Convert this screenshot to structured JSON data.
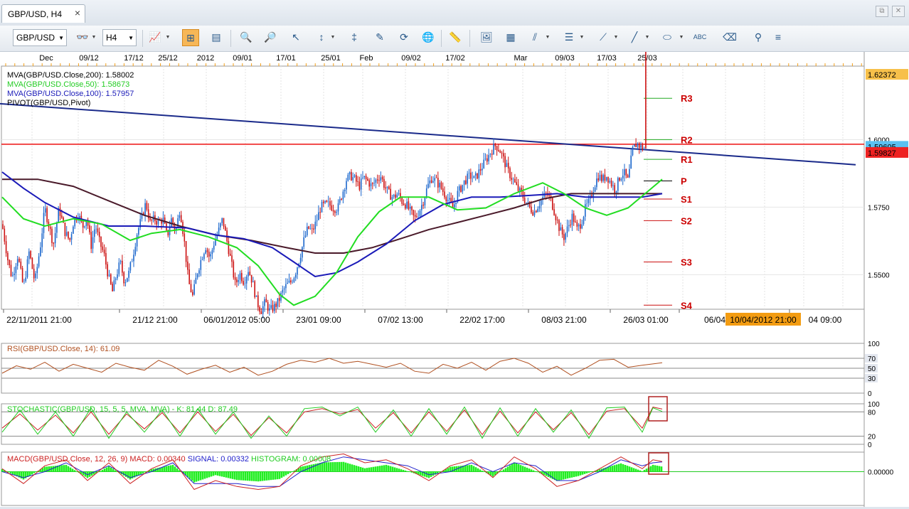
{
  "window": {
    "tab_title": "GBP/USD, H4",
    "close_glyph": "×",
    "restore_glyph": "⧉",
    "close_window_glyph": "✕"
  },
  "toolbar": {
    "symbol": "GBP/USD",
    "timeframe": "H4",
    "icons": [
      "glasses-icon",
      "chart-type-icon",
      "zoom-fit-icon",
      "data-window-icon",
      "zoom-in-icon",
      "zoom-out-icon",
      "cursor-icon",
      "indicator-icon",
      "cross-line-icon",
      "template-icon",
      "refresh-icon",
      "globe-icon",
      "ruler-icon",
      "image-icon",
      "screenshot-icon",
      "fibonacci-icon",
      "channel-icon",
      "trendline-icon",
      "line-icon",
      "ellipse-icon",
      "text-icon",
      "eraser-icon",
      "layout-icon",
      "menu-icon"
    ]
  },
  "colors": {
    "mva200": "#4a1a2a",
    "mva50": "#22dd22",
    "mva100": "#1a1ab8",
    "pivot": "#000000",
    "trendline": "#1a2a8a",
    "hline": "#ee1111",
    "pivot_label": "#cc0000",
    "bull": "#1a66cc",
    "bear": "#cc1111",
    "rsi": "#b05020",
    "stoch_k": "#22cc22",
    "stoch_d": "#cc2222",
    "macd": "#cc2222",
    "signal": "#2222cc",
    "hist": "#22ee22",
    "price_tag_current": "#5bc0f0",
    "price_tag_line": "#ee2222",
    "price_tag_top": "#f7c04a",
    "time_tag": "#f39c12"
  },
  "chart_data": [
    {
      "type": "candlestick",
      "symbol": "GBP/USD",
      "timeframe": "H4",
      "top_axis": [
        "Dec",
        "09/12",
        "17/12",
        "25/12",
        "2012",
        "09/01",
        "17/01",
        "25/01",
        "Feb",
        "09/02",
        "17/02",
        "Mar",
        "09/03",
        "17/03",
        "25/03"
      ],
      "bottom_axis": [
        "22/11/2011 21:00",
        "21/12 21:00",
        "06/01/2012 05:00",
        "23/01 09:00",
        "07/02 13:00",
        "22/02 17:00",
        "08/03 21:00",
        "26/03 01:00",
        "06/04",
        "04 09:00"
      ],
      "cursor_time_label": "10/04/2012 21:00",
      "ylim": [
        1.5372,
        1.6272
      ],
      "y_ticks": [
        1.55,
        1.575,
        1.6
      ],
      "y_tick_labels": [
        "1.5500",
        "1.5750",
        "1.6000"
      ],
      "price_tags": {
        "top": "1.62372",
        "current": "1.59605",
        "line": "1.59827"
      },
      "legend": [
        {
          "text": "MVA(GBP/USD.Close,200): 1.58002",
          "color": "#000000"
        },
        {
          "text": "MVA(GBP/USD.Close,50): 1.58673",
          "color": "#22cc22"
        },
        {
          "text": "MVA(GBP/USD.Close,100): 1.57957",
          "color": "#1a1ab8"
        },
        {
          "text": "PIVOT(GBP/USD,Pivot)",
          "color": "#000000"
        }
      ],
      "close_path": {
        "x": [
          0,
          8,
          14,
          22,
          30,
          38,
          46,
          54,
          60,
          66,
          72,
          80,
          88,
          95,
          100,
          107,
          113,
          119,
          125,
          131,
          137,
          143,
          149,
          155,
          160,
          166,
          172,
          178,
          184,
          190,
          196,
          202,
          208,
          214,
          220,
          226,
          232,
          238,
          244,
          250,
          256,
          262,
          268,
          274,
          280,
          286,
          292,
          298,
          304,
          310,
          316,
          322,
          328,
          334,
          340,
          346,
          352,
          358,
          364,
          370,
          376,
          382,
          388,
          394,
          400,
          406,
          412,
          418,
          424,
          430,
          436,
          442,
          448,
          454,
          460,
          466,
          472,
          478,
          484,
          490,
          496,
          502,
          508,
          514,
          520,
          526,
          532,
          538,
          544,
          550,
          556,
          562,
          568,
          574,
          580,
          586,
          592,
          598,
          604,
          610,
          616,
          622,
          628,
          634,
          640,
          646,
          652,
          658,
          664,
          670,
          676,
          682,
          688,
          694,
          700,
          706,
          712,
          718,
          724,
          730,
          736,
          742,
          748,
          754,
          760,
          766,
          772,
          778,
          784,
          790,
          796,
          802,
          808,
          814,
          820,
          826,
          832,
          838,
          844,
          850,
          856,
          862,
          868,
          874,
          880,
          886,
          892,
          898,
          904,
          910,
          916,
          922,
          928
        ],
        "y": [
          1.5687,
          1.5556,
          1.5488,
          1.5573,
          1.5451,
          1.5587,
          1.5472,
          1.5613,
          1.5747,
          1.5681,
          1.5613,
          1.5747,
          1.5661,
          1.5626,
          1.5693,
          1.5728,
          1.5676,
          1.5713,
          1.5607,
          1.5686,
          1.562,
          1.5579,
          1.55,
          1.5437,
          1.5494,
          1.5547,
          1.5474,
          1.5506,
          1.5574,
          1.5659,
          1.5708,
          1.5767,
          1.5693,
          1.5707,
          1.5693,
          1.5707,
          1.5641,
          1.5707,
          1.5659,
          1.5747,
          1.5626,
          1.5474,
          1.542,
          1.5506,
          1.556,
          1.5607,
          1.556,
          1.562,
          1.5661,
          1.5707,
          1.5626,
          1.5547,
          1.5462,
          1.5506,
          1.5474,
          1.552,
          1.5474,
          1.54,
          1.5367,
          1.54,
          1.5367,
          1.538,
          1.54,
          1.5437,
          1.5462,
          1.5474,
          1.5506,
          1.556,
          1.5626,
          1.5674,
          1.566,
          1.57,
          1.5752,
          1.5759,
          1.576,
          1.5747,
          1.5747,
          1.58,
          1.5853,
          1.5867,
          1.5853,
          1.5827,
          1.586,
          1.5847,
          1.5827,
          1.5853,
          1.5867,
          1.5827,
          1.58,
          1.5786,
          1.58,
          1.5773,
          1.576,
          1.5734,
          1.5707,
          1.5734,
          1.5773,
          1.5827,
          1.586,
          1.5847,
          1.5827,
          1.58,
          1.5773,
          1.5747,
          1.58,
          1.5827,
          1.5853,
          1.5867,
          1.5853,
          1.588,
          1.5907,
          1.5933,
          1.596,
          1.598,
          1.596,
          1.592,
          1.588,
          1.5853,
          1.582,
          1.58,
          1.5773,
          1.5747,
          1.5733,
          1.576,
          1.5786,
          1.58,
          1.5773,
          1.572,
          1.5667,
          1.564,
          1.568,
          1.572,
          1.5667,
          1.5693,
          1.5747,
          1.5773,
          1.5827,
          1.5867,
          1.5853,
          1.5867,
          1.584,
          1.5813,
          1.586,
          1.588,
          1.5847,
          1.596,
          1.5987,
          1.5973,
          1.5965
        ]
      },
      "mva50_path": {
        "x": [
          0,
          30,
          60,
          100,
          140,
          180,
          210,
          250,
          290,
          330,
          360,
          390,
          410,
          440,
          470,
          500,
          530,
          560,
          600,
          640,
          680,
          720,
          760,
          790,
          820,
          850,
          880,
          910,
          928
        ],
        "y": [
          1.5787,
          1.5707,
          1.568,
          1.5707,
          1.5687,
          1.5627,
          1.5653,
          1.5667,
          1.564,
          1.56,
          1.5533,
          1.5427,
          1.5387,
          1.542,
          1.5507,
          1.564,
          1.5733,
          1.5787,
          1.5787,
          1.574,
          1.5747,
          1.58,
          1.584,
          1.58,
          1.5747,
          1.572,
          1.5747,
          1.5813,
          1.5853
        ]
      },
      "mva100_path": {
        "x": [
          0,
          30,
          60,
          100,
          150,
          200,
          260,
          300,
          340,
          380,
          410,
          440,
          470,
          500,
          540,
          580,
          620,
          660,
          700,
          740,
          780,
          820,
          860,
          900,
          928
        ],
        "y": [
          1.588,
          1.582,
          1.5767,
          1.5713,
          1.568,
          1.568,
          1.5673,
          1.5647,
          1.5633,
          1.56,
          1.5547,
          1.5493,
          1.5507,
          1.5547,
          1.5613,
          1.57,
          1.576,
          1.5787,
          1.5787,
          1.5793,
          1.58,
          1.5787,
          1.5787,
          1.5787,
          1.58
        ]
      },
      "mva200_path": {
        "x": [
          0,
          50,
          100,
          150,
          200,
          250,
          300,
          350,
          400,
          440,
          480,
          520,
          560,
          600,
          640,
          680,
          720,
          760,
          800,
          840,
          880,
          928
        ],
        "y": [
          1.5853,
          1.5853,
          1.5827,
          1.5773,
          1.572,
          1.568,
          1.5647,
          1.5627,
          1.56,
          1.558,
          1.558,
          1.56,
          1.5633,
          1.5667,
          1.5693,
          1.572,
          1.5747,
          1.578,
          1.58,
          1.58,
          1.58,
          1.58
        ]
      },
      "trendline": {
        "x": [
          0,
          1203
        ],
        "y": [
          1.6133,
          1.5907
        ]
      },
      "hline": 1.59827,
      "pivots": [
        {
          "label": "R3",
          "value": 1.6153
        },
        {
          "label": "R2",
          "value": 1.6
        },
        {
          "label": "R1",
          "value": 1.5927
        },
        {
          "label": "P",
          "value": 1.5847
        },
        {
          "label": "S1",
          "value": 1.578
        },
        {
          "label": "S2",
          "value": 1.57
        },
        {
          "label": "S3",
          "value": 1.5547
        },
        {
          "label": "S4",
          "value": 1.5387
        }
      ]
    },
    {
      "type": "line",
      "name": "RSI(GBP/USD.Close, 14): 61.09",
      "ylim": [
        0,
        100
      ],
      "levels": [
        30,
        50,
        70
      ],
      "tick_labels": [
        "100",
        "70",
        "50",
        "30",
        "0"
      ],
      "path": {
        "x": [
          0,
          20,
          40,
          60,
          80,
          100,
          120,
          140,
          160,
          180,
          200,
          220,
          240,
          260,
          280,
          300,
          320,
          340,
          360,
          380,
          400,
          420,
          440,
          460,
          480,
          500,
          520,
          540,
          560,
          580,
          600,
          620,
          640,
          660,
          680,
          700,
          720,
          740,
          760,
          780,
          800,
          820,
          840,
          860,
          880,
          900,
          928
        ],
        "y": [
          40,
          55,
          48,
          62,
          44,
          58,
          50,
          42,
          60,
          52,
          46,
          66,
          54,
          38,
          48,
          56,
          42,
          52,
          36,
          44,
          58,
          66,
          62,
          70,
          60,
          64,
          58,
          52,
          60,
          44,
          40,
          58,
          50,
          62,
          46,
          64,
          70,
          60,
          42,
          54,
          36,
          50,
          66,
          68,
          52,
          56,
          61
        ]
      }
    },
    {
      "type": "line",
      "name": "STOCHASTIC(GBP/USD, 15, 5, 5, MVA, MVA) -  K: 81.44   D: 87.49",
      "ylim": [
        0,
        100
      ],
      "levels": [
        20,
        80
      ],
      "tick_labels": [
        "100",
        "80",
        "20",
        "0"
      ],
      "k_path": {
        "x": [
          0,
          25,
          50,
          75,
          100,
          125,
          150,
          175,
          200,
          225,
          250,
          275,
          300,
          325,
          350,
          375,
          400,
          425,
          450,
          475,
          500,
          525,
          550,
          575,
          600,
          625,
          650,
          675,
          700,
          725,
          750,
          775,
          800,
          825,
          850,
          875,
          900,
          915,
          928
        ],
        "y": [
          30,
          85,
          25,
          80,
          20,
          90,
          15,
          80,
          30,
          85,
          20,
          88,
          25,
          80,
          15,
          70,
          20,
          88,
          92,
          70,
          92,
          30,
          85,
          20,
          88,
          25,
          92,
          15,
          90,
          20,
          88,
          30,
          85,
          15,
          90,
          92,
          30,
          90,
          81
        ]
      },
      "d_path": {
        "x": [
          0,
          25,
          50,
          75,
          100,
          125,
          150,
          175,
          200,
          225,
          250,
          275,
          300,
          325,
          350,
          375,
          400,
          425,
          450,
          475,
          500,
          525,
          550,
          575,
          600,
          625,
          650,
          675,
          700,
          725,
          750,
          775,
          800,
          825,
          850,
          875,
          900,
          915,
          928
        ],
        "y": [
          40,
          75,
          35,
          72,
          28,
          80,
          25,
          75,
          38,
          78,
          28,
          80,
          32,
          74,
          22,
          66,
          28,
          80,
          88,
          75,
          86,
          40,
          78,
          28,
          80,
          32,
          85,
          24,
          82,
          28,
          80,
          36,
          78,
          24,
          82,
          88,
          40,
          92,
          87
        ]
      }
    },
    {
      "type": "line",
      "name": "MACD(GBP/USD.Close, 12, 26, 9)",
      "macd_label": "MACD: 0.00340",
      "signal_label": "SIGNAL: 0.00332",
      "hist_label": "HISTOGRAM: 0.00008",
      "ylim": [
        -0.009,
        0.009
      ],
      "tick_labels": [
        "0.00000"
      ],
      "macd_path": {
        "x": [
          0,
          30,
          60,
          90,
          120,
          150,
          180,
          210,
          240,
          270,
          300,
          330,
          360,
          390,
          420,
          450,
          480,
          510,
          540,
          570,
          600,
          630,
          660,
          690,
          720,
          750,
          780,
          810,
          840,
          870,
          900,
          915,
          928
        ],
        "y": [
          0.001,
          -0.004,
          0.002,
          0.004,
          -0.003,
          0.003,
          -0.004,
          0.001,
          0.004,
          -0.006,
          -0.003,
          -0.005,
          -0.006,
          -0.005,
          0.002,
          0.005,
          0.006,
          0.003,
          0.004,
          0.001,
          -0.003,
          0.002,
          0.004,
          -0.002,
          0.005,
          0.001,
          -0.005,
          -0.003,
          0.001,
          0.005,
          0.001,
          0.004,
          0.0034
        ]
      },
      "signal_path": {
        "x": [
          0,
          30,
          60,
          90,
          120,
          150,
          180,
          210,
          240,
          270,
          300,
          330,
          360,
          390,
          420,
          450,
          480,
          510,
          540,
          570,
          600,
          630,
          660,
          690,
          720,
          750,
          780,
          810,
          840,
          870,
          900,
          915,
          928
        ],
        "y": [
          0.0,
          -0.002,
          0.0,
          0.003,
          -0.001,
          0.002,
          -0.002,
          0.0,
          0.003,
          -0.004,
          -0.004,
          -0.004,
          -0.005,
          -0.005,
          0.0,
          0.003,
          0.005,
          0.004,
          0.003,
          0.002,
          -0.001,
          0.0,
          0.003,
          0.0,
          0.003,
          0.002,
          -0.003,
          -0.003,
          0.0,
          0.004,
          0.002,
          0.003,
          0.0033
        ]
      }
    }
  ]
}
